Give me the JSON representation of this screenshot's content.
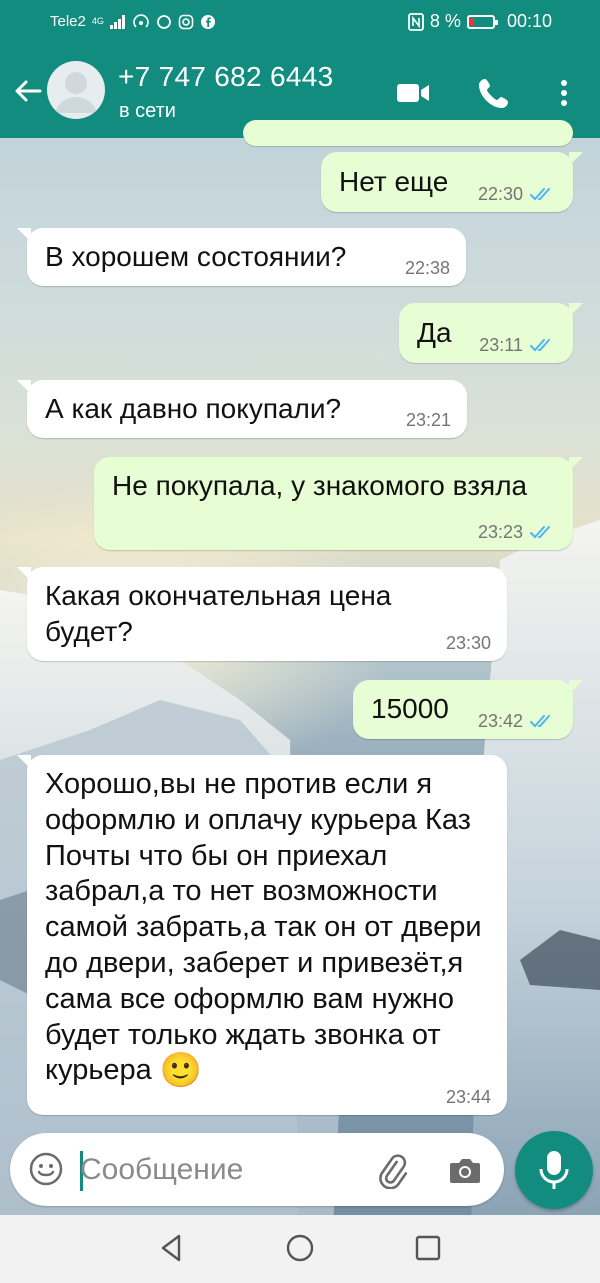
{
  "status_bar": {
    "carrier": "Tele2",
    "network": "4G",
    "battery": "8 %",
    "time": "00:10"
  },
  "header": {
    "contact": "+7 747 682 6443",
    "status": "в сети"
  },
  "messages": [
    {
      "dir": "out",
      "text": "Нет еще",
      "time": "22:30",
      "read": true
    },
    {
      "dir": "in",
      "text": "В хорошем состоянии?",
      "time": "22:38"
    },
    {
      "dir": "out",
      "text": "Да",
      "time": "23:11",
      "read": true
    },
    {
      "dir": "in",
      "text": "А как давно покупали?",
      "time": "23:21"
    },
    {
      "dir": "out",
      "text": "Не покупала, у знакомого взяла",
      "time": "23:23",
      "read": true
    },
    {
      "dir": "in",
      "text": "Какая окончательная цена будет?",
      "time": "23:30"
    },
    {
      "dir": "out",
      "text": "15000",
      "time": "23:42",
      "read": true
    },
    {
      "dir": "in",
      "text": "Хорошо,вы не против если я оформлю и оплачу курьера Каз Почты что бы он приехал забрал,а то нет возможности самой забрать,а так он от двери до двери, заберет и привезёт,я сама все оформлю вам нужно будет только ждать звонка от курьера",
      "emoji": "🙂",
      "time": "23:44"
    }
  ],
  "composer": {
    "placeholder": "Сообщение"
  },
  "colors": {
    "brand": "#128c7e",
    "outgoing_bubble": "#e7fdd4",
    "read_ticks": "#4fb3f6"
  }
}
